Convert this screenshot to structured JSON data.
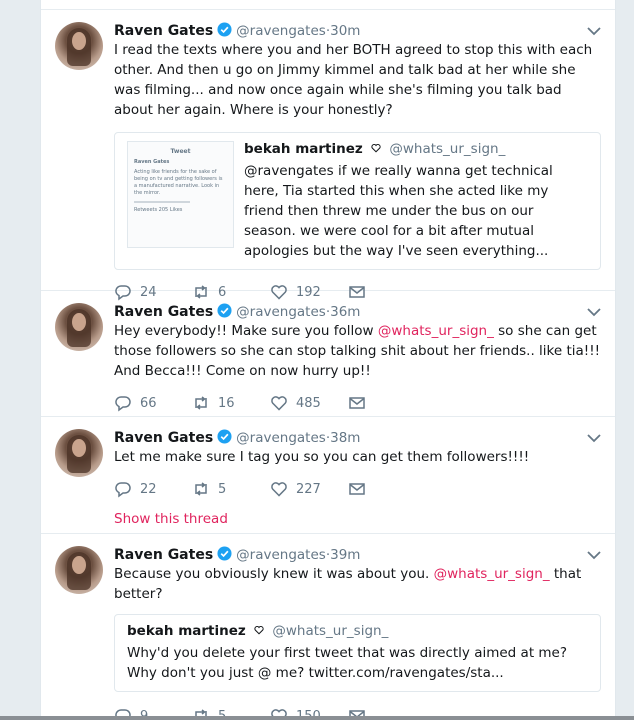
{
  "tweets": [
    {
      "name": "Raven Gates",
      "handle": "@ravengates",
      "sep": "·",
      "time": "30m",
      "text": "I read the texts where you and her BOTH agreed to stop this with each other. And then u go on Jimmy kimmel and talk bad at her while she was filming... and now once again while she's filming you talk bad about her again. Where is your honestly?",
      "quote": {
        "name": "bekah martinez",
        "handle": "@whats_ur_sign_",
        "text": "@ravengates if we really wanna get technical here, Tia started this when she acted like my friend then threw me under the bus on our season. we were cool for a bit after mutual apologies but the way I've seen everything...",
        "image_title": "Tweet",
        "image_name": "Raven Gates",
        "image_text": "Acting like friends for the sake of being on tv and getting followers is a manufactured narrative. Look in the mirror.",
        "image_stats": "Retweets 205 Likes"
      },
      "replies": "24",
      "retweets": "6",
      "likes": "192"
    },
    {
      "name": "Raven Gates",
      "handle": "@ravengates",
      "sep": "·",
      "time": "36m",
      "text_before": "Hey everybody!! Make sure you follow ",
      "text_mention": "@whats_ur_sign_",
      "text_after": " so she can get those followers so she can stop talking shit about her friends.. like tia!!! And Becca!!! Come on now hurry up!!",
      "replies": "66",
      "retweets": "16",
      "likes": "485"
    },
    {
      "name": "Raven Gates",
      "handle": "@ravengates",
      "sep": "·",
      "time": "38m",
      "text": "Let me make sure I tag you so you can get them followers!!!!",
      "replies": "22",
      "retweets": "5",
      "likes": "227",
      "thread_link": "Show this thread"
    },
    {
      "name": "Raven Gates",
      "handle": "@ravengates",
      "sep": "·",
      "time": "39m",
      "text_before": "Because you obviously knew it was about you. ",
      "text_mention": "@whats_ur_sign_",
      "text_after": " that better?",
      "quote": {
        "name": "bekah martinez",
        "handle": "@whats_ur_sign_",
        "text": "Why'd you delete your first tweet that was directly aimed at me? Why don't you just @ me? twitter.com/ravengates/sta..."
      },
      "replies": "9",
      "retweets": "5",
      "likes": "150"
    }
  ],
  "colors": {
    "background": "#e6ecf0",
    "verified": "#1da1f2",
    "mention": "#e0245e",
    "muted": "#657786"
  },
  "icons": [
    "verified-badge-icon",
    "chevron-down-icon",
    "reply-icon",
    "retweet-icon",
    "like-icon",
    "direct-message-icon"
  ]
}
